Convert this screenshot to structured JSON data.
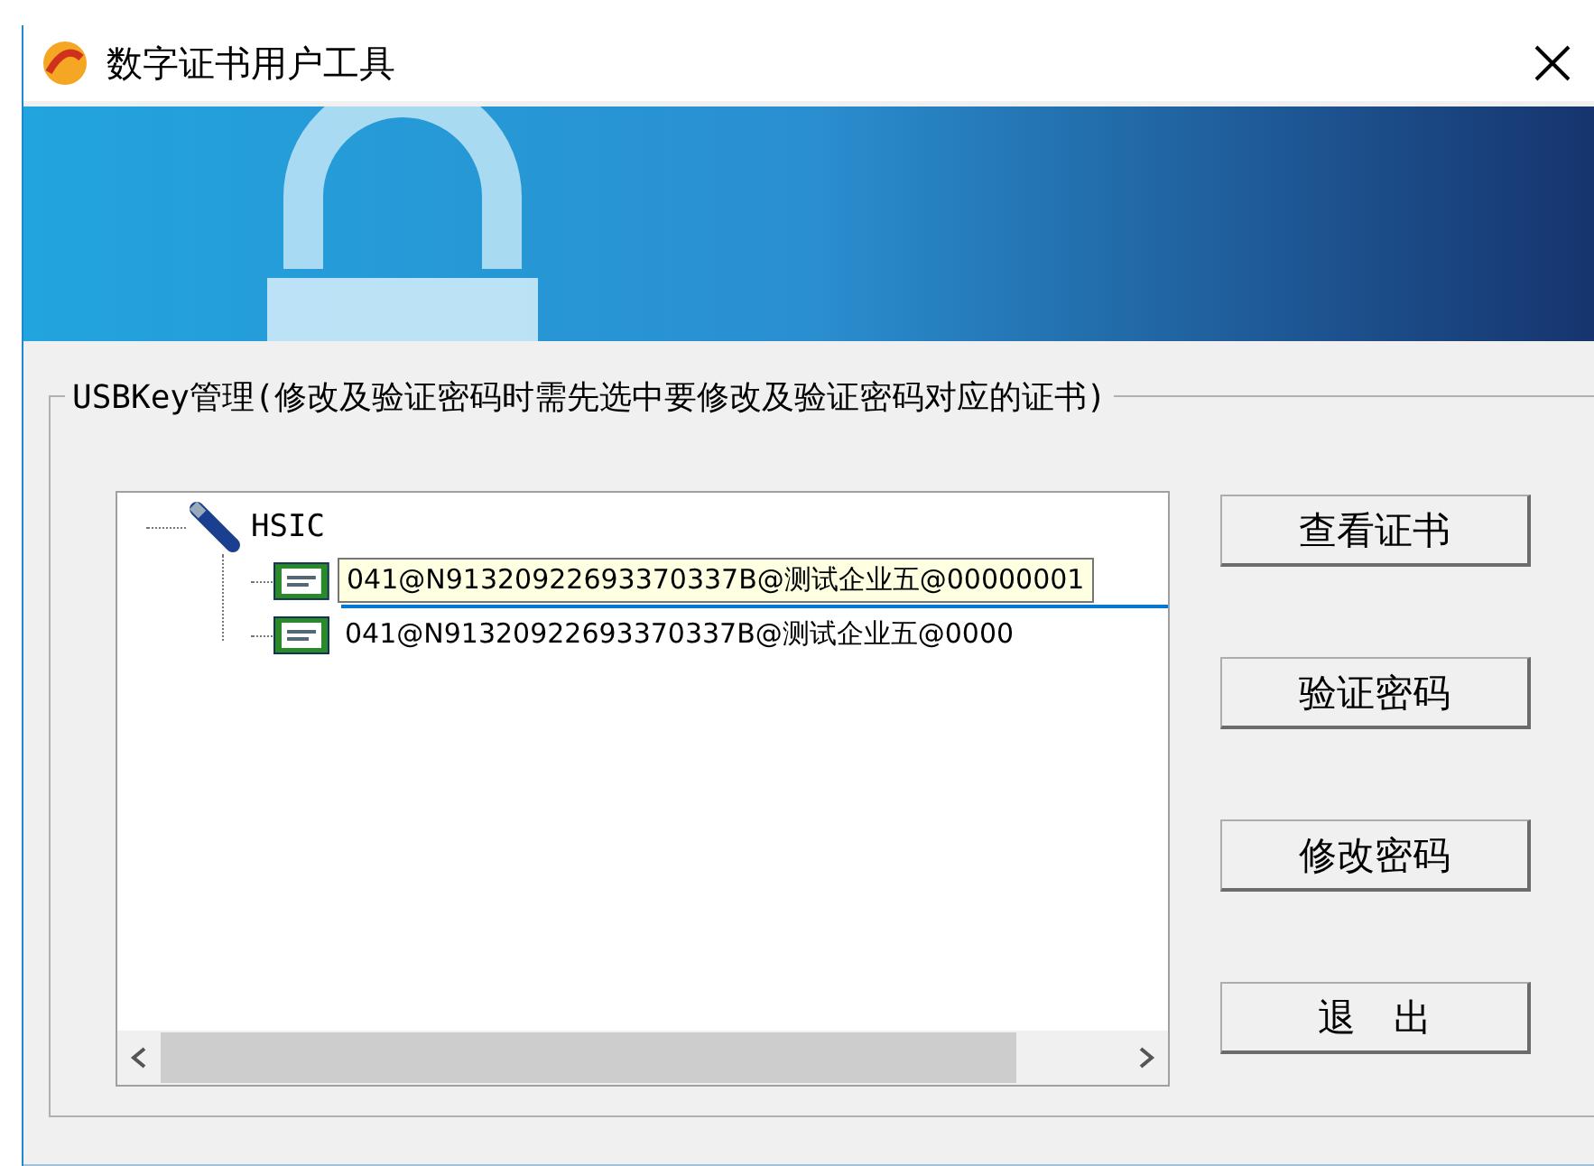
{
  "window": {
    "title": "数字证书用户工具"
  },
  "group": {
    "title": "USBKey管理(修改及验证密码时需先选中要修改及验证密码对应的证书)"
  },
  "tree": {
    "root": {
      "label": "HSIC",
      "children": [
        {
          "selected": true,
          "tooltip": "041@N91320922693370337B@测试企业五@00000001"
        },
        {
          "label": "041@N91320922693370337B@测试企业五@0000",
          "selected": false
        }
      ]
    }
  },
  "buttons": [
    "查看证书",
    "验证密码",
    "修改密码",
    "退　出"
  ]
}
